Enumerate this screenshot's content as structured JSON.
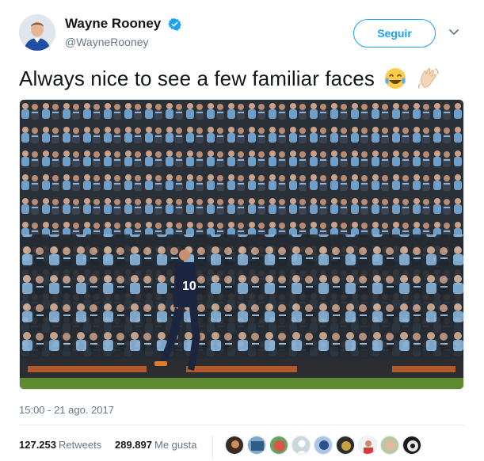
{
  "user": {
    "display_name": "Wayne Rooney",
    "handle": "@WayneRooney",
    "verified": true,
    "avatar_icon": "profile-photo-everton-kit"
  },
  "header": {
    "follow_label": "Seguir",
    "menu_icon": "chevron-down-icon"
  },
  "tweet": {
    "text": "Always nice to see a few familiar faces",
    "emojis": [
      "tears-of-joy-emoji",
      "waving-hand-emoji"
    ],
    "media": {
      "type": "photo",
      "description_icon": "stadium-crowd-photo"
    }
  },
  "meta": {
    "timestamp": "15:00 - 21 ago. 2017"
  },
  "stats": {
    "retweets_count": "127.253",
    "retweets_label": "Retweets",
    "likes_count": "289.897",
    "likes_label": "Me gusta",
    "likers_count": 9
  },
  "colors": {
    "accent": "#1da1f2",
    "text": "#14171a",
    "secondary_text": "#657786",
    "border": "#e6ecf0"
  }
}
